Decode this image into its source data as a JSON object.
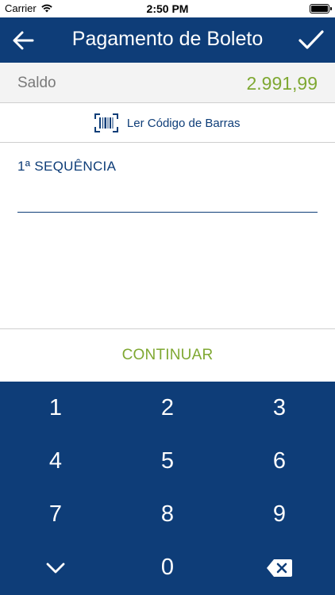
{
  "status_bar": {
    "carrier": "Carrier",
    "time": "2:50 PM",
    "icons": [
      "wifi-icon",
      "battery-icon"
    ]
  },
  "nav": {
    "title": "Pagamento de Boleto",
    "back_icon": "arrow-left-icon",
    "confirm_icon": "checkmark-icon"
  },
  "balance": {
    "label": "Saldo",
    "value": "2.991,99"
  },
  "barcode": {
    "label": "Ler Código de Barras",
    "icon": "barcode-scan-icon"
  },
  "sequence": {
    "label": "1ª SEQUÊNCIA",
    "value": ""
  },
  "continue": {
    "label": "CONTINUAR"
  },
  "keypad": {
    "keys": [
      "1",
      "2",
      "3",
      "4",
      "5",
      "6",
      "7",
      "8",
      "9",
      "0"
    ],
    "hide_icon": "chevron-down-icon",
    "delete_icon": "backspace-icon"
  },
  "colors": {
    "primary": "#0e3d78",
    "accent": "#7fa832",
    "muted_text": "#7a7a7a",
    "row_background": "#f3f3f3"
  }
}
